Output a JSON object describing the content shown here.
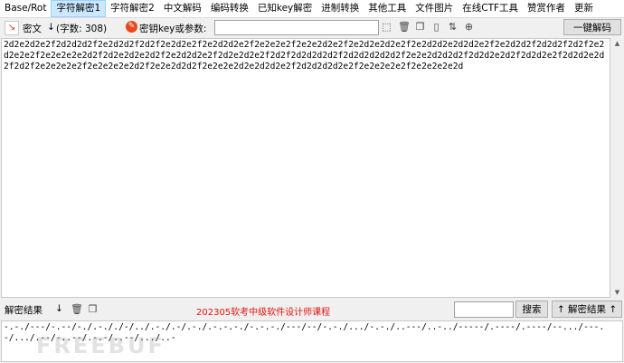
{
  "menu": [
    {
      "label": "Base/Rot",
      "active": false
    },
    {
      "label": "字符解密1",
      "active": true
    },
    {
      "label": "字符解密2",
      "active": false
    },
    {
      "label": "中文解码",
      "active": false
    },
    {
      "label": "编码转换",
      "active": false
    },
    {
      "label": "已知key解密",
      "active": false
    },
    {
      "label": "进制转换",
      "active": false
    },
    {
      "label": "其他工具",
      "active": false
    },
    {
      "label": "文件图片",
      "active": false
    },
    {
      "label": "在线CTF工具",
      "active": false
    },
    {
      "label": "赞赏作者",
      "active": false
    },
    {
      "label": "更新",
      "active": false
    }
  ],
  "toolbar": {
    "ciphertext_label": "密文",
    "char_count_label": "(字数: 308)",
    "key_label": "密钥key或参数:",
    "key_value": "",
    "decrypt_button": "一键解码"
  },
  "ciphertext": "2d2e2d2e2f2d2d2d2f2e2d2d2f2d2f2e2d2e2f2e2d2d2e2f2e2e2e2f2e2e2d2e2f2e2d2e2d2e2f2e2d2d2e2d2d2e2f2e2d2d2f2d2d2f2d2f2e2d2e2e2f2e2e2e2e2d2f2d2e2d2e2d2f2e2d2d2e2f2d2e2d2e2f2d2f2d2d2d2d2f2d2d2d2d2d2f2e2e2d2d2d2f2d2d2e2d2f2d2d2e2f2d2d2e2d2f2d2f2e2e2e2e2f2e2e2e2e2d2f2e2e2d2d2f2e2e2e2d2e2d2d2e2f2d2d2d2d2e2f2e2e2e2e2f2e2e2e2e2d",
  "bottom": {
    "result_label": "解密结果",
    "promo_text": "202305软考中级软件设计师课程",
    "search_value": "",
    "search_button": "搜索",
    "result_button": "解密结果"
  },
  "result": "-.-./---/-.--/-./.-././-/../.-./.-/.-./.-.-.-./-.-.-./---/--/-.-./.../-.-./..---/..-../-----/.----/.----/--.../---.-/.../.--/-..--/.-.-/..--/.../..-",
  "watermark": "FREEBUF",
  "colors": {
    "promo": "#e0160f",
    "menu_active": "#cce8ff"
  }
}
